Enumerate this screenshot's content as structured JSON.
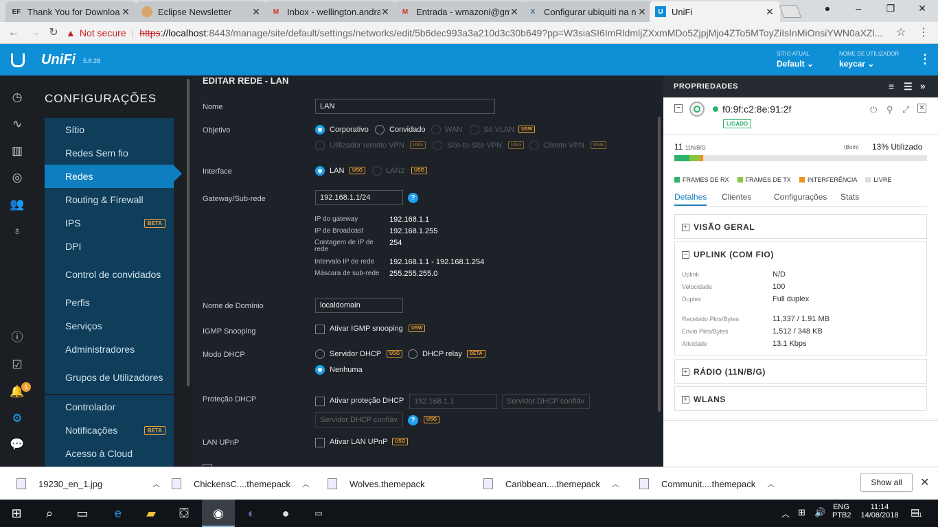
{
  "tabs": [
    {
      "label": "Thank You for Downloa",
      "icon": "EF"
    },
    {
      "label": "Eclipse Newsletter",
      "icon": "mailchimp"
    },
    {
      "label": "Inbox - wellington.andra",
      "icon": "M"
    },
    {
      "label": "Entrada - wmazoni@gm",
      "icon": "M"
    },
    {
      "label": "Configurar ubiquiti na n",
      "icon": "X"
    },
    {
      "label": "UniFi",
      "icon": "U"
    }
  ],
  "address": {
    "not_secure": "Not secure",
    "https": "https",
    "host": "://localhost",
    "rest": ":8443/manage/site/default/settings/networks/edit/5b6dec993a3a210d3c30b649?pp=W3siaSI6ImRldmljZXxmMDo5ZjpjMjo4ZTo5MToyZiIsInMiOnsiYWN0aXZl..."
  },
  "header": {
    "brand": "UniFi",
    "version": "5.8.28",
    "site_label": "SÍTIO ATUAL",
    "site_value": "Default",
    "user_label": "NOME DE UTILIZADOR",
    "user_value": "keycar"
  },
  "sidebar": {
    "title": "CONFIGURAÇÕES",
    "alert_count": "1",
    "beta": "BETA",
    "items": [
      "Sítio",
      "Redes Sem fio",
      "Redes",
      "Routing & Firewall",
      "IPS",
      "DPI",
      "Control de convidados",
      "Perfis",
      "Serviços",
      "Administradores",
      "Grupos de Utilizadores"
    ],
    "items2": [
      "Controlador",
      "Notificações",
      "Acesso à Cloud"
    ]
  },
  "form": {
    "title": "EDITAR REDE - LAN",
    "name_label": "Nome",
    "name_value": "LAN",
    "purpose_label": "Objetivo",
    "purpose": {
      "corp": "Corporativo",
      "guest": "Convidado",
      "wan": "WAN",
      "vlan": "Só VLAN",
      "remote": "Utilizador remoto VPN",
      "s2s": "Site-to-Site VPN",
      "client": "Cliente VPN"
    },
    "tag_usw": "USW",
    "tag_usg": "USG",
    "tag_beta": "BETA",
    "interface_label": "Interface",
    "iface_lan": "LAN",
    "iface_lan2": "LAN2",
    "gw_label": "Gateway/Sub-rede",
    "gw_value": "192.168.1.1/24",
    "help": "?",
    "info": [
      {
        "k": "IP do gateway",
        "v": "192.168.1.1"
      },
      {
        "k": "IP de Broadcast",
        "v": "192.168.1.255"
      },
      {
        "k": "Contagem de IP de rede",
        "v": "254"
      },
      {
        "k": "Intervalo IP de rede",
        "v": "192.168.1.1 - 192.168.1.254"
      },
      {
        "k": "Máscara de sub-rede",
        "v": "255.255.255.0"
      }
    ],
    "domain_label": "Nome de Domínio",
    "domain_value": "localdomain",
    "igmp_label": "IGMP Snooping",
    "igmp_opt": "Ativar IGMP snooping",
    "dhcp_label": "Modo DHCP",
    "dhcp_server": "Servidor DHCP",
    "dhcp_relay": "DHCP relay",
    "dhcp_none": "Nenhuma",
    "guard_label": "Proteção DHCP",
    "guard_opt": "Ativar proteção DHCP",
    "guard_ip": "192.168.1.1",
    "guard_ph": "Servidor DHCP confiáv",
    "upnp_label": "LAN UPnP",
    "upnp_opt": "Ativar LAN UPnP"
  },
  "props": {
    "title": "PROPRIEDADES",
    "mac": "f0:9f:c2:8e:91:2f",
    "status": "LIGADO",
    "channel": "11",
    "band": "11N/B/G",
    "quality": "(Bom)",
    "util": "13% Utilizado",
    "legend": [
      "FRAMES DE RX",
      "FRAMES DE TX",
      "INTERFERÊNCIA",
      "LIVRE"
    ],
    "legend_colors": [
      "#2db36b",
      "#8cc63f",
      "#f0931e",
      "#ddd"
    ],
    "util_rx": 0.06,
    "util_tx": 0.04,
    "util_int": 0.015,
    "tabs": [
      "Detalhes",
      "Clientes",
      "Configurações",
      "Stats"
    ],
    "sections": {
      "overview": "VISÃO GERAL",
      "uplink": "UPLINK (COM FIO)",
      "radio": "RÁDIO (11N/B/G)",
      "wlans": "WLANS"
    },
    "uplink": [
      {
        "k": "Uplink",
        "v": "N/D"
      },
      {
        "k": "Velocidade",
        "v": "100"
      },
      {
        "k": "Duplex",
        "v": "Full duplex"
      },
      {
        "k": "Recebido Pkts/Bytes",
        "v": "11,337 / 1.91 MB"
      },
      {
        "k": "Envio Pkts/Bytes",
        "v": "1,512 / 348 KB"
      },
      {
        "k": "Atividade",
        "v": "13.1 Kbps"
      }
    ]
  },
  "downloads": [
    "19230_en_1.jpg",
    "ChickensC....themepack",
    "Wolves.themepack",
    "Caribbean....themepack",
    "Communit....themepack"
  ],
  "show_all": "Show all",
  "tray": {
    "lang": "ENG",
    "kbd": "PTB2",
    "time": "11:14",
    "date": "14/08/2018",
    "notif": "1"
  }
}
